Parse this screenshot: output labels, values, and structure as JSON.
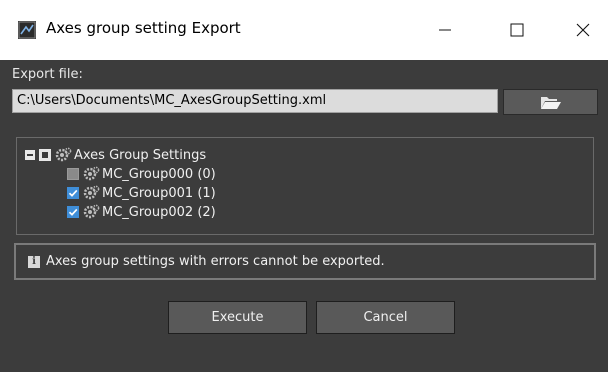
{
  "window": {
    "title": "Axes group setting Export",
    "icons": [
      "app-icon",
      "minimize-icon",
      "maximize-icon",
      "close-icon"
    ]
  },
  "export_file": {
    "label": "Export file:",
    "path": "C:\\Users\\Documents\\MC_AxesGroupSetting.xml",
    "browse_icon": "folder-open-icon"
  },
  "tree": {
    "root": {
      "label": "Axes Group Settings",
      "state": "partial",
      "expanded": true
    },
    "items": [
      {
        "label": "MC_Group000 (0)",
        "checked": false
      },
      {
        "label": "MC_Group001 (1)",
        "checked": true
      },
      {
        "label": "MC_Group002 (2)",
        "checked": true
      }
    ]
  },
  "info": {
    "icon": "info-icon",
    "text": "Axes group settings with errors cannot be exported."
  },
  "buttons": {
    "execute": "Execute",
    "cancel": "Cancel"
  },
  "colors": {
    "dialog_bg": "#3c3c3c",
    "checkbox_checked": "#3f8ed8",
    "button_bg": "#595959"
  }
}
